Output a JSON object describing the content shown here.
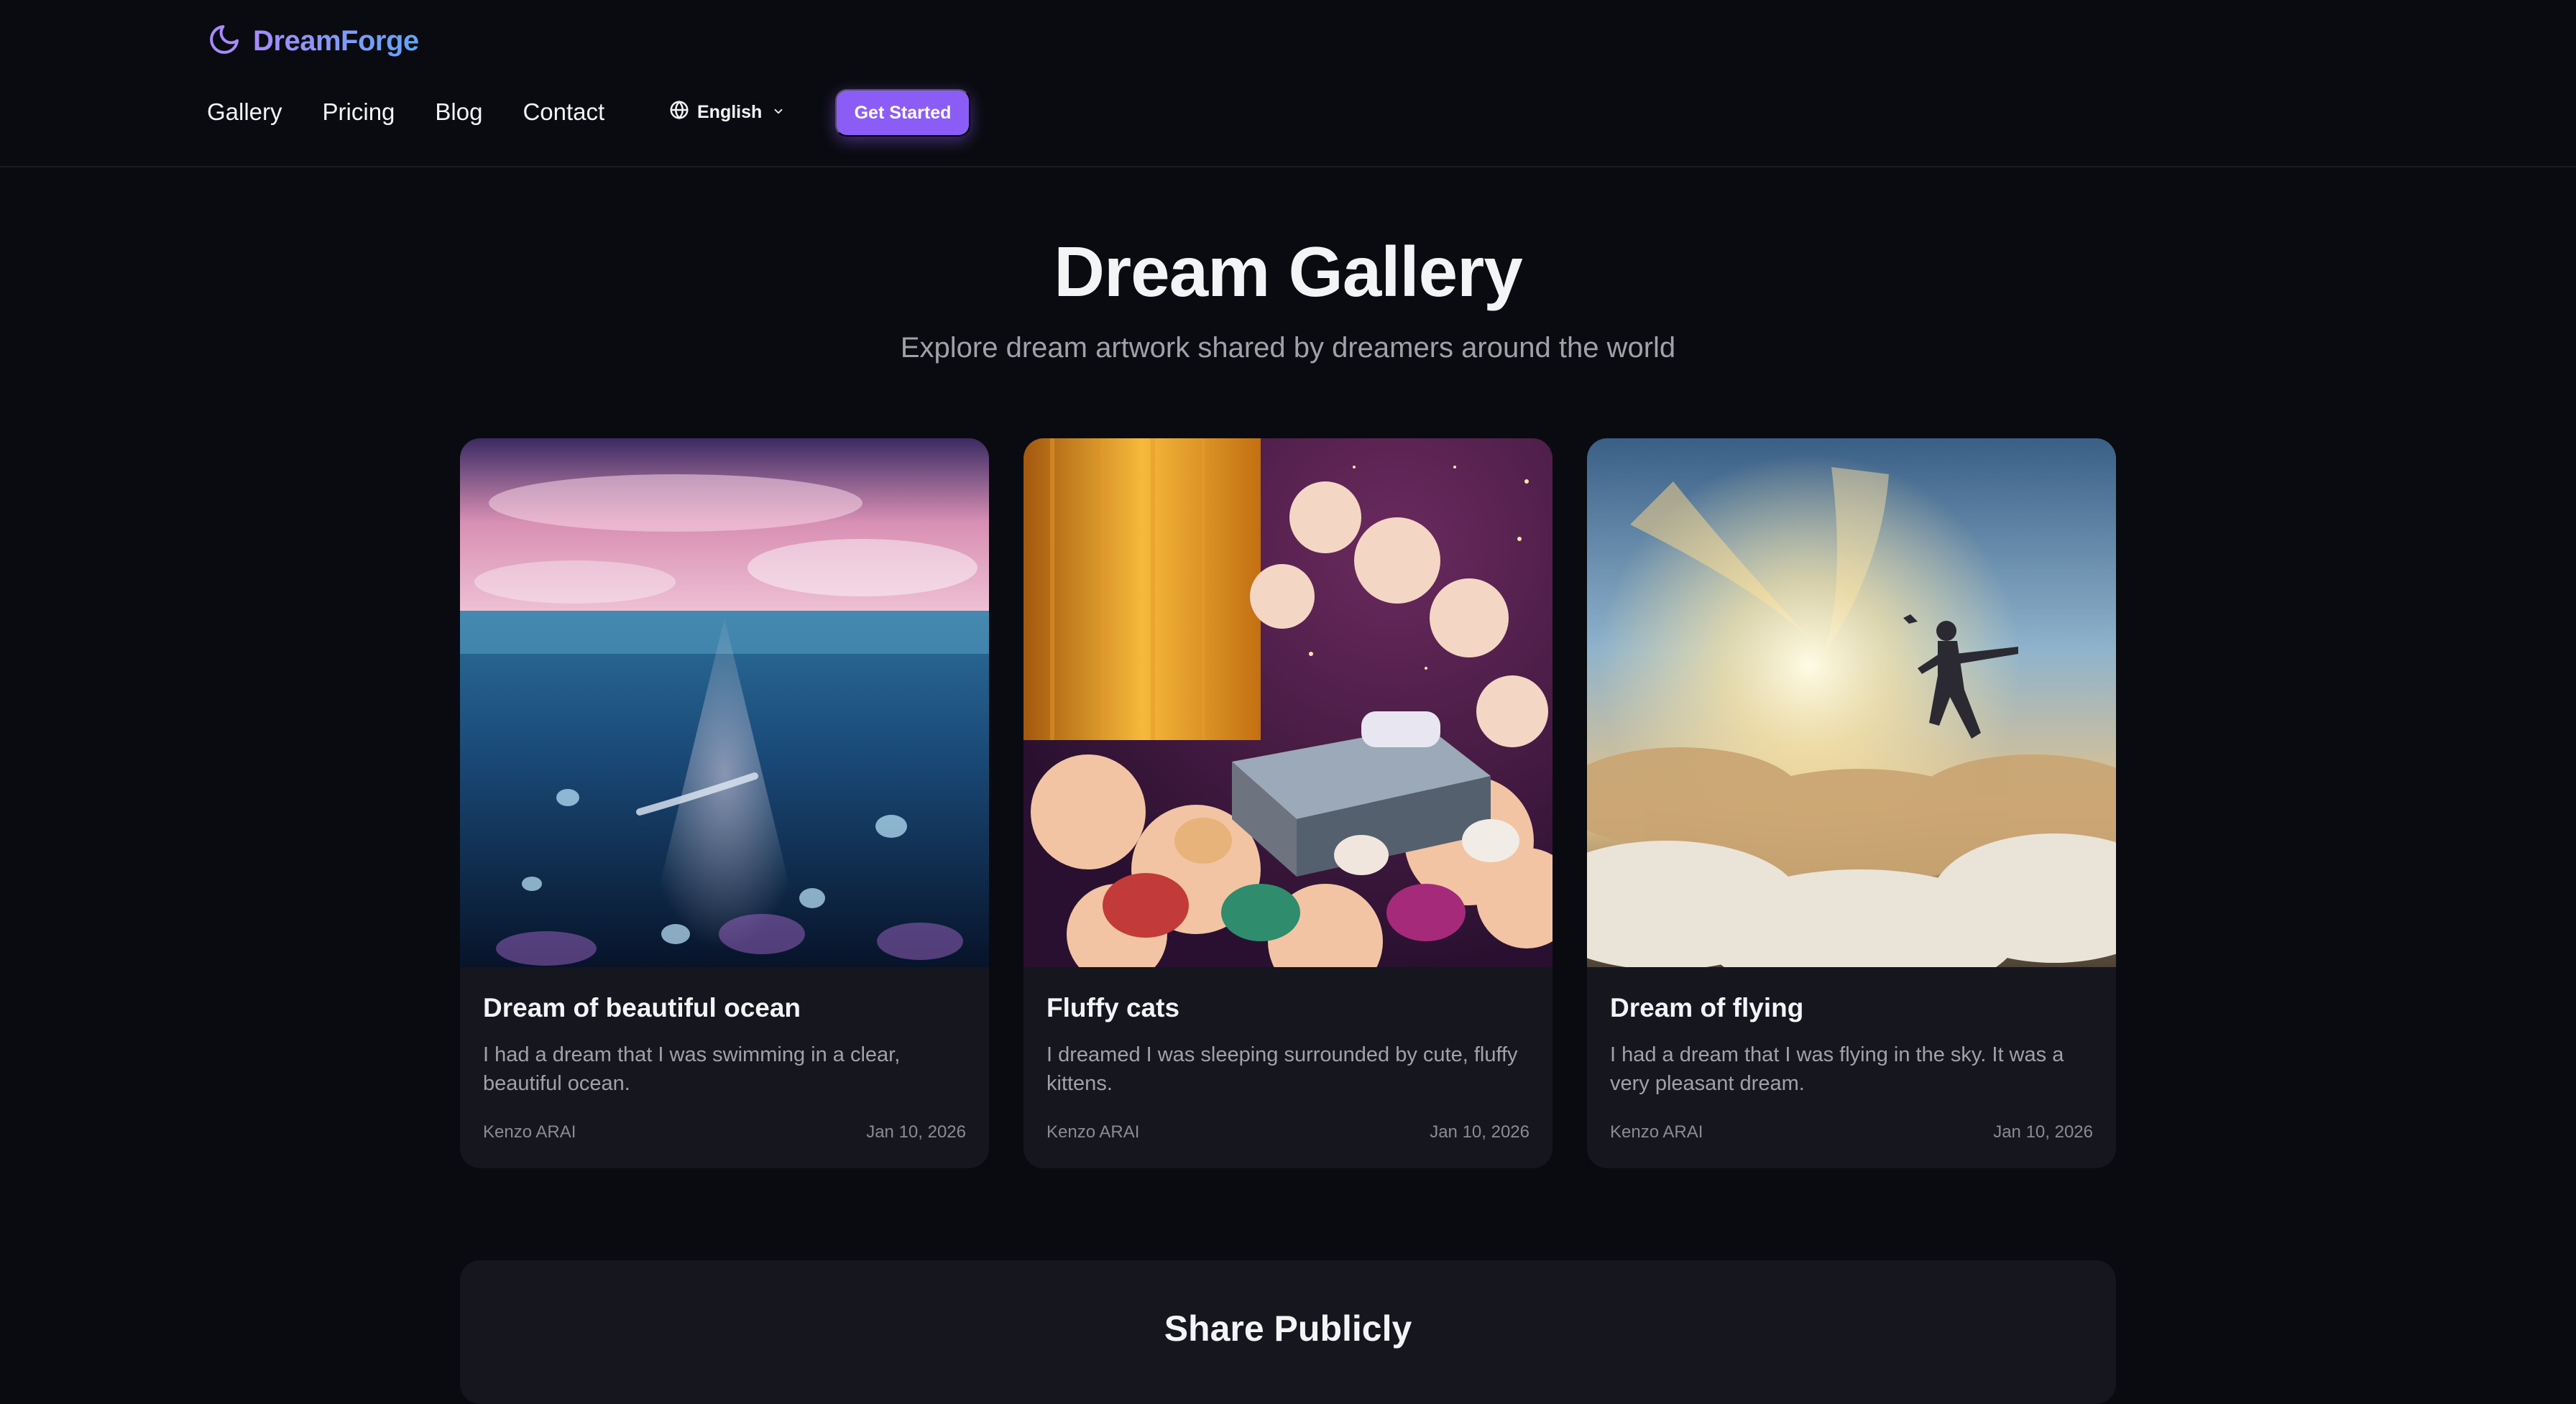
{
  "brand": {
    "name": "DreamForge",
    "icon": "moon-icon",
    "gradient": [
      "#a78bfa",
      "#60a5fa"
    ]
  },
  "nav": {
    "links": [
      "Gallery",
      "Pricing",
      "Blog",
      "Contact"
    ],
    "language": {
      "icon": "globe-icon",
      "selected": "English",
      "dropdown_icon": "chevron-down-icon"
    },
    "cta_label": "Get Started"
  },
  "hero": {
    "title": "Dream Gallery",
    "subtitle": "Explore dream artwork shared by dreamers around the world"
  },
  "gallery": {
    "cards": [
      {
        "title": "Dream of beautiful ocean",
        "description": "I had a dream that I was swimming in a clear, beautiful ocean.",
        "author": "Kenzo ARAI",
        "date": "Jan 10, 2026",
        "image": "ocean-dream-image"
      },
      {
        "title": "Fluffy cats",
        "description": "I dreamed I was sleeping surrounded by cute, fluffy kittens.",
        "author": "Kenzo ARAI",
        "date": "Jan 10, 2026",
        "image": "cats-dream-image"
      },
      {
        "title": "Dream of flying",
        "description": "I had a dream that I was flying in the sky. It was a very pleasant dream.",
        "author": "Kenzo ARAI",
        "date": "Jan 10, 2026",
        "image": "flying-dream-image"
      }
    ]
  },
  "share": {
    "title": "Share Publicly"
  },
  "colors": {
    "background": "#0a0b10",
    "card": "#15161e",
    "accent": "#8b5cf6",
    "muted_text": "#a1a1aa"
  }
}
